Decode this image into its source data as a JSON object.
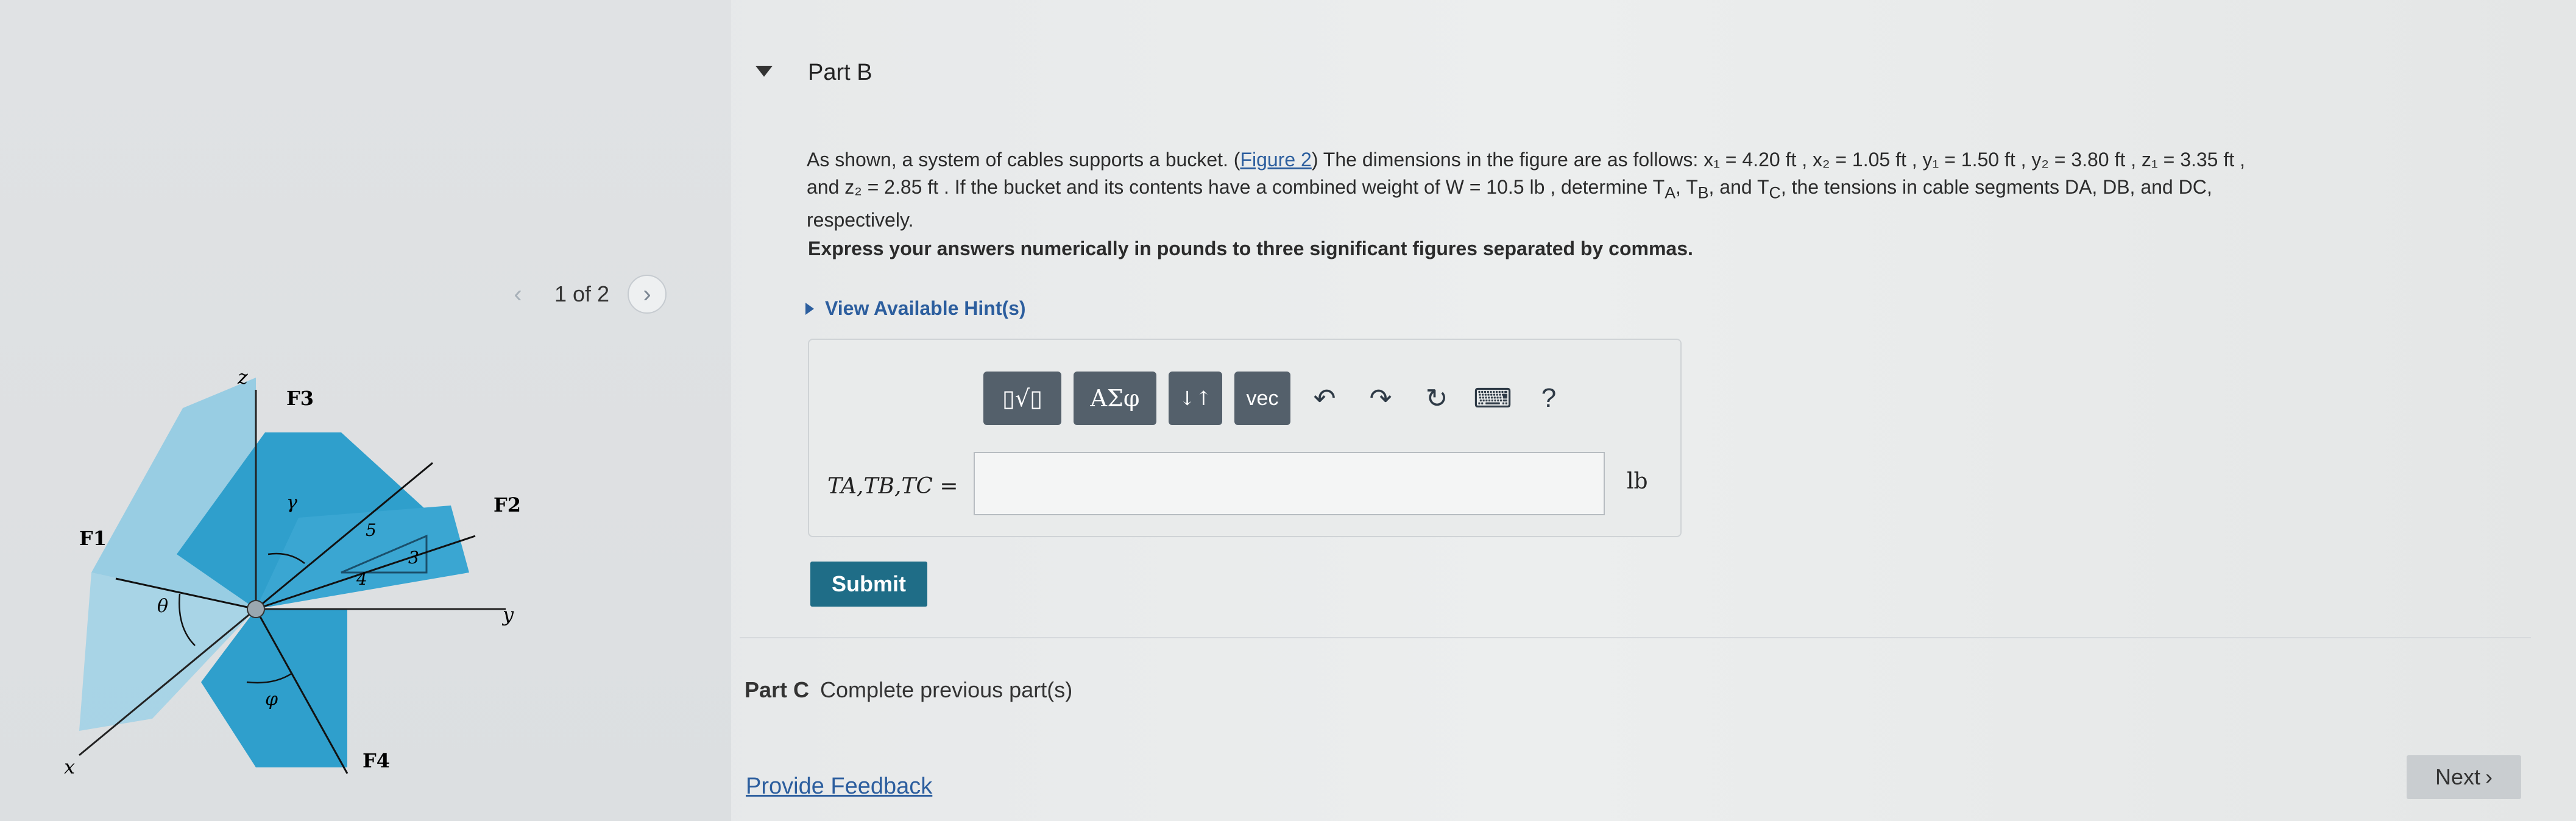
{
  "figure_pager": {
    "prev_icon": "chevron-left-icon",
    "text": "1 of 2",
    "next_icon": "chevron-right-icon"
  },
  "figure": {
    "labels": {
      "z": "z",
      "y": "y",
      "x": "x",
      "f1": "F1",
      "f2": "F2",
      "f3": "F3",
      "f4": "F4",
      "theta": "θ",
      "phi": "φ",
      "gamma": "γ",
      "n5": "5",
      "n4": "4",
      "n3": "3"
    },
    "colors": {
      "plane_blue": "#2f9fcc",
      "plane_light": "#8cc9e3"
    }
  },
  "part_b": {
    "title": "Part B",
    "text_1": "As shown, a system of cables supports a bucket. (",
    "figure_link": "Figure 2",
    "text_2": ") The dimensions in the figure are as follows: x₁ = 4.20 ft , x₂ = 1.05 ft , y₁ = 1.50 ft , y₂ = 3.80 ft , z₁ = 3.35 ft ,",
    "text_3": "and z₂ = 2.85 ft . If the bucket and its contents have a combined weight of W = 10.5 lb , determine T",
    "text_4": "respectively.",
    "sub_a": "A",
    "sub_b": "B",
    "sub_c": "C",
    "tb_1": ", T",
    "tb_2": ", and T",
    "tb_3": ", the tensions in cable segments DA, DB, and DC,",
    "instruction": "Express your answers numerically in pounds to three significant figures separated by commas.",
    "hints_label": "View Available Hint(s)"
  },
  "toolbar": {
    "templates": "▯√▯",
    "greek": "ΑΣφ",
    "updown": "↓↑",
    "vec": "vec",
    "undo_icon": "undo-icon",
    "redo_icon": "redo-icon",
    "reset_icon": "reset-icon",
    "keyboard_icon": "keyboard-icon",
    "help": "?"
  },
  "answer": {
    "label": "TA,TB,TC =",
    "value": "",
    "unit": "lb"
  },
  "submit_label": "Submit",
  "part_c": {
    "title": "Part C",
    "status": "Complete previous part(s)"
  },
  "feedback_label": "Provide Feedback",
  "next_label": "Next",
  "colors": {
    "link": "#2c5e9e",
    "submit_bg": "#1f6d87",
    "toolbar_bg": "#54606b"
  }
}
